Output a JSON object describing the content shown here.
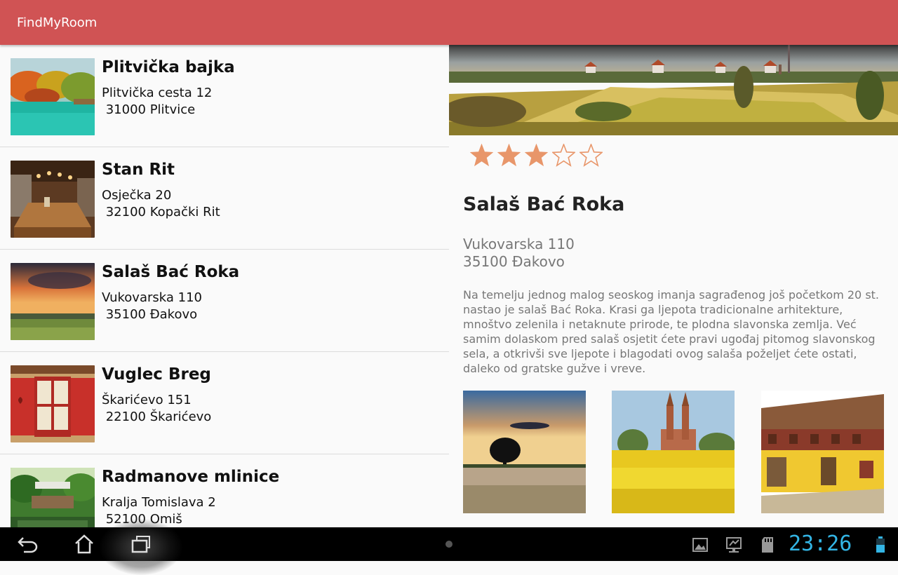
{
  "app": {
    "title": "FindMyRoom",
    "accent": "#d05354"
  },
  "list": [
    {
      "name": "Plitvička bajka",
      "address_line1": "Plitvička cesta 12",
      "address_line2": " 31000 Plitvice",
      "image": "autumn-lake-photo"
    },
    {
      "name": "Stan Rit",
      "address_line1": "Osječka 20",
      "address_line2": " 32100 Kopački Rit",
      "image": "rustic-dining-room-photo"
    },
    {
      "name": "Salaš Bać Roka",
      "address_line1": "Vukovarska 110",
      "address_line2": " 35100 Đakovo",
      "image": "sunset-field-photo"
    },
    {
      "name": "Vuglec Breg",
      "address_line1": "Škarićevo 151",
      "address_line2": " 22100 Škarićevo",
      "image": "red-window-shutters-photo"
    },
    {
      "name": "Radmanove mlinice",
      "address_line1": "Kralja Tomislava 2",
      "address_line2": " 52100 Omiš",
      "image": "riverside-terrace-photo"
    }
  ],
  "detail": {
    "name": "Salaš Bać Roka",
    "address_line1": "Vukovarska 110",
    "address_line2": "35100 Đakovo",
    "rating": 3,
    "rating_max": 5,
    "star_color": "#e8966a",
    "description": "Na temelju jednog malog seoskog imanja sagrađenog još početkom 20 st. nastao je salaš Bać Roka. Krasi ga ljepota tradicionalne arhitekture, mnoštvo zelenila i netaknute prirode, te plodna slavonska zemlja. Već samim dolaskom pred salaš osjetit ćete pravi ugođaj pitomog slavonskog sela, a otkrivši sve ljepote i blagodati ovog salaša poželjet ćete ostati, daleko od gratske gužve i vreve.",
    "hero_image": "village-fields-panorama",
    "gallery": [
      "tree-sunset-wheat-photo",
      "cathedral-rapeseed-photo",
      "yellow-farmhouse-photo"
    ]
  },
  "system_bar": {
    "clock": "23:26",
    "clock_color": "#33b5e5",
    "icons": [
      "back-icon",
      "home-icon",
      "recent-apps-icon",
      "gallery-notification-icon",
      "usb-debugging-icon",
      "sd-card-icon",
      "battery-icon"
    ]
  }
}
